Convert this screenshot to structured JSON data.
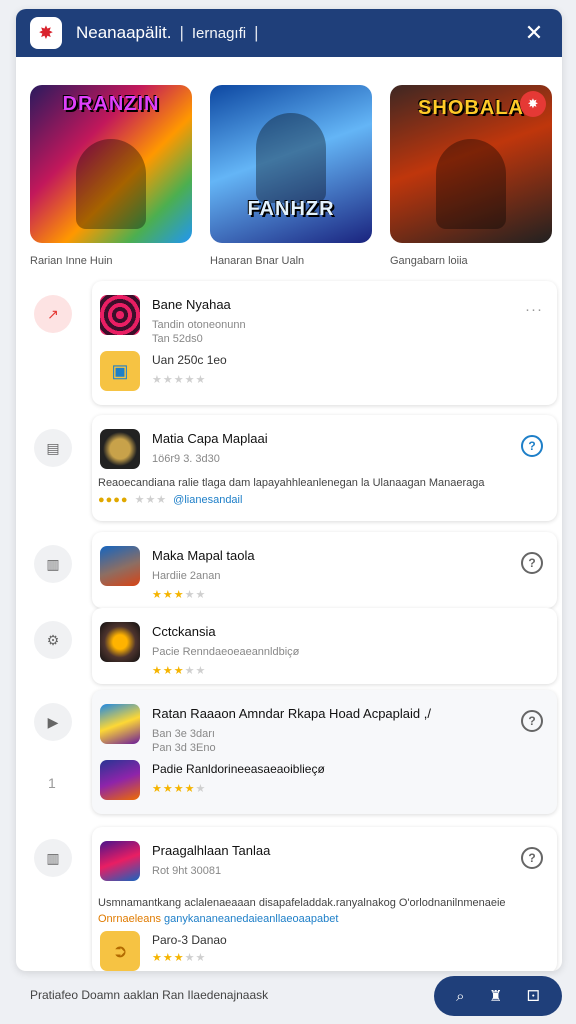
{
  "window": {
    "logo_glyph": "✸",
    "title": "Neanaapälit.",
    "title_separator": "|",
    "subtitle": "Iernagıfi",
    "subtitle_end": "|",
    "close_label": "✕"
  },
  "featured": [
    {
      "thumb_title": "DRANZIN",
      "caption": "Rarian Inne Huin"
    },
    {
      "thumb_title": "FANHZR",
      "caption": "Hanaran Bnar Ualn"
    },
    {
      "thumb_title": "SHOBALA",
      "caption": "Gangabarn loiia",
      "badge": "✸"
    }
  ],
  "sidebar_numbers": {
    "row5_second": "1"
  },
  "rows": [
    {
      "entries": [
        {
          "name": "Bane Nyahaa",
          "meta": "Tandin otoneonunn",
          "meta2": "Tan 52ds0",
          "icon": "pattern-icon"
        },
        {
          "name": "Uan 250c 1eo",
          "meta": "",
          "stars_on": 0,
          "stars_total": 5,
          "icon": "app-store-icon"
        }
      ],
      "action": "···"
    },
    {
      "entries": [
        {
          "name": "Matia Capa Maplaai",
          "meta": "1ö6r9 3. 3d30",
          "icon": "knight-icon"
        }
      ],
      "desc": "Reaoecandiana ralie tlaga dam lapayahhleanlenegan la Ulanaagan Manaeraga",
      "rating_gold": "●●●●",
      "rating_tag": "@lianesandail",
      "action": "?"
    },
    {
      "entries": [
        {
          "name": "Maka Mapal taola",
          "meta": "Hardiie 2anan",
          "stars_on": 3,
          "stars_total": 5,
          "icon": "warrior-icon"
        }
      ],
      "action": "?"
    },
    {
      "entries": [
        {
          "name": "Cctckansia",
          "meta": "Pacie Renndaeoeaeannldbiçø",
          "stars_on": 3,
          "stars_total": 5,
          "icon": "mech-icon"
        }
      ],
      "action": ""
    },
    {
      "entries": [
        {
          "name": "Ratan Raaaon Amndar Rkapa Hoad Acpaplaid ,/",
          "meta": "Ban 3e 3darı",
          "meta2": "Pan 3d 3Eno",
          "icon": "tower-icon"
        },
        {
          "name": "Padie Ranldorineeasaeaoiblieçø",
          "meta": "",
          "stars_on": 4,
          "stars_total": 5,
          "icon": "rogue-icon"
        }
      ],
      "action": "?"
    },
    {
      "entries": [
        {
          "name": "Praagalhlaan Tanlaa",
          "meta": "Rot 9ht 30081",
          "icon": "hero-icon"
        },
        {
          "name": "Paro-3 Danao",
          "meta": "",
          "stars_on": 3,
          "stars_total": 5,
          "icon": "coin-icon"
        }
      ],
      "desc": "Usmnamantkang aclalenaeaaan disapafeladdak.ranyalnakog  O'orlodnanilnmenaeie",
      "desc2_orange": "Onrnaeleans",
      "desc2_blue": " ganykananeanedaieanllaeoaapabet",
      "action": "?"
    }
  ],
  "footer": {
    "text": "Pratiafeo Doamn aaklan    Ran Ilaedenajnaask",
    "buttons": [
      "⌕",
      "♜",
      "⚀"
    ]
  },
  "colors": {
    "brand": "#1f3f7a",
    "star": "#f5b400",
    "link": "#1e7fc8",
    "alert": "#e53935"
  }
}
